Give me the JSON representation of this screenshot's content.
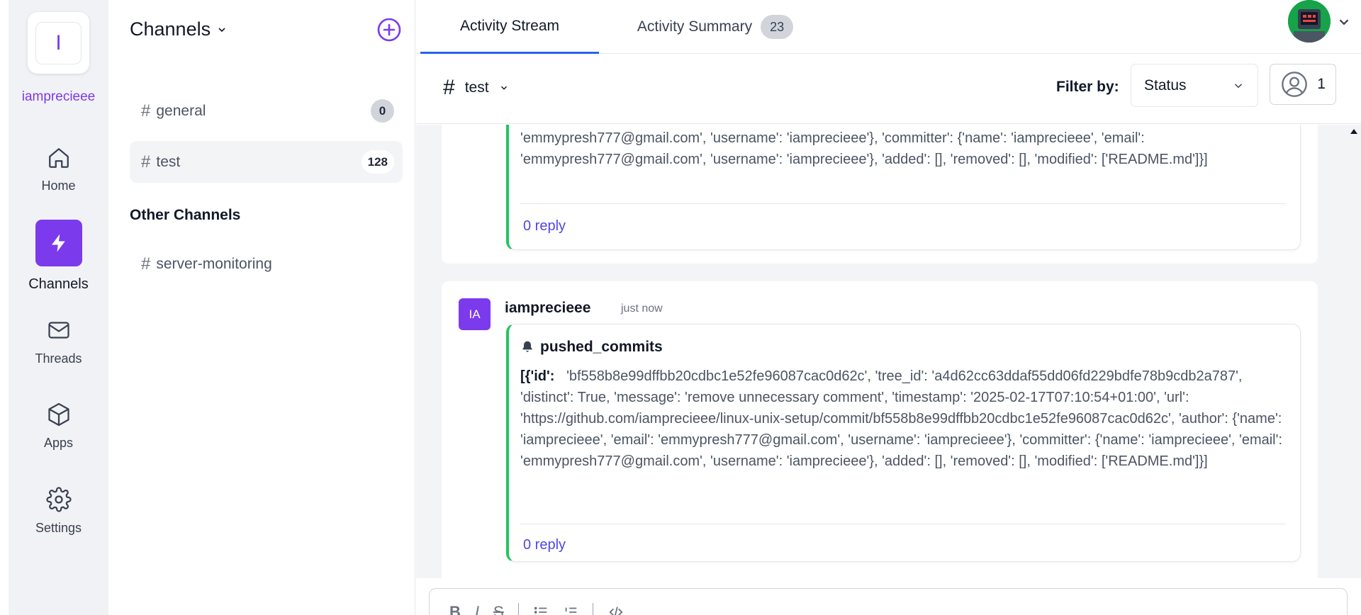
{
  "org": {
    "initial": "I",
    "name": "iamprecieee"
  },
  "nav": [
    {
      "label": "Home",
      "icon": "home-icon"
    },
    {
      "label": "Channels",
      "icon": "lightning-icon",
      "active": true
    },
    {
      "label": "Threads",
      "icon": "mail-icon"
    },
    {
      "label": "Apps",
      "icon": "cube-icon"
    },
    {
      "label": "Settings",
      "icon": "gear-icon"
    }
  ],
  "channels": {
    "title": "Channels",
    "items": [
      {
        "name": "general",
        "count": "0"
      },
      {
        "name": "test",
        "count": "128",
        "selected": true
      }
    ],
    "other_title": "Other Channels",
    "other_items": [
      {
        "name": "server-monitoring"
      }
    ]
  },
  "tabs": [
    {
      "label": "Activity Stream",
      "active": true
    },
    {
      "label": "Activity Summary",
      "badge": "23"
    }
  ],
  "filter": {
    "hash": "#",
    "channel": "test",
    "label": "Filter by:",
    "status": "Status",
    "user_count": "1"
  },
  "messages": [
    {
      "body_partial": "'emmypresh777@gmail.com', 'username': 'iamprecieee'}, 'committer': {'name': 'iamprecieee', 'email': 'emmypresh777@gmail.com', 'username': 'iamprecieee'}, 'added': [], 'removed': [], 'modified': ['README.md']}]",
      "reply": "0 reply"
    },
    {
      "avatar": "IA",
      "sender": "iamprecieee",
      "time": "just now",
      "event": "pushed_commits",
      "body_prefix": "[{'id':",
      "body": "'bf558b8e99dffbb20cdbc1e52fe96087cac0d62c', 'tree_id': 'a4d62cc63ddaf55dd06fd229bdfe78b9cdb2a787', 'distinct': True, 'message': 'remove unnecessary comment', 'timestamp': '2025-02-17T07:10:54+01:00', 'url': 'https://github.com/iamprecieee/linux-unix-setup/commit/bf558b8e99dffbb20cdbc1e52fe96087cac0d62c', 'author': {'name': 'iamprecieee', 'email': 'emmypresh777@gmail.com', 'username': 'iamprecieee'}, 'committer': {'name': 'iamprecieee', 'email': 'emmypresh777@gmail.com', 'username': 'iamprecieee'}, 'added': [], 'removed': [], 'modified': ['README.md']}]",
      "reply": "0 reply"
    }
  ],
  "composer": {
    "tools": [
      "B",
      "I",
      "S",
      "list",
      "ordered-list",
      "code"
    ]
  },
  "colors": {
    "accent": "#7c3aed",
    "link": "#4f46e5",
    "tab_active": "#2563eb",
    "card_border": "#22c55e"
  }
}
